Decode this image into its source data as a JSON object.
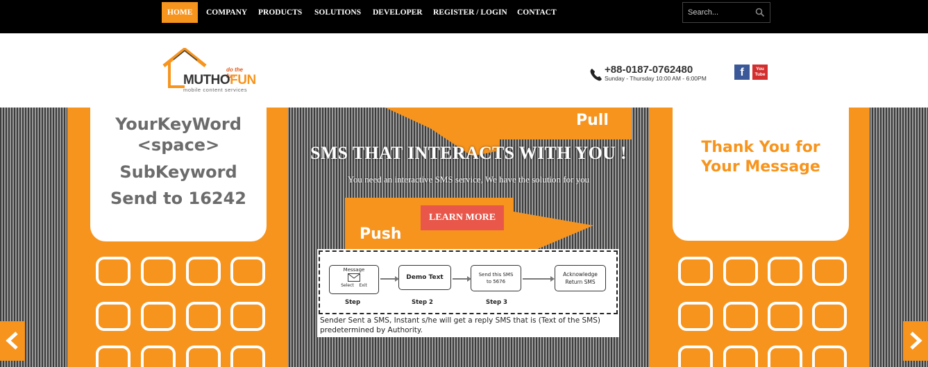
{
  "nav": {
    "items": [
      {
        "label": "HOME",
        "active": true
      },
      {
        "label": "COMPANY"
      },
      {
        "label": "PRODUCTS"
      },
      {
        "label": "SOLUTIONS"
      },
      {
        "label": "DEVELOPER"
      },
      {
        "label": "REGISTER / LOGIN"
      },
      {
        "label": "CONTACT"
      }
    ],
    "search_placeholder": "Search...",
    "search_icon": "search-icon"
  },
  "header": {
    "logo": {
      "tagline": "do the fun",
      "brand_a": "MUTHO",
      "brand_b": "FUN",
      "subtitle": "mobile content services"
    },
    "phone": {
      "icon": "phone-icon",
      "number": "+88-0187-0762480",
      "hours": "Sunday - Thursday 10:00 AM - 6:00PM"
    },
    "social": [
      {
        "name": "facebook-icon",
        "glyph": "f"
      },
      {
        "name": "youtube-icon",
        "glyph": "You Tube"
      }
    ]
  },
  "hero": {
    "left_screen": [
      "YourKeyWord",
      "<space>",
      "SubKeyword",
      "Send to 16242"
    ],
    "right_screen": [
      "Thank You for",
      "Your Message"
    ],
    "pull_label": "Pull",
    "push_label": "Push",
    "title": "SMS THAT INTERACTS WITH YOU !",
    "subtitle": "You need an interactive SMS service, We have the solution for you",
    "cta": "LEARN MORE",
    "prev_icon": "chevron-left-icon",
    "next_icon": "chevron-right-icon",
    "colors": {
      "accent": "#f7941d",
      "cta": "#e8574a"
    }
  },
  "diagram": {
    "steps": [
      {
        "title": "Message",
        "select": "Select",
        "exit": "Exit",
        "label": "Step"
      },
      {
        "title": "Demo Text",
        "label": "Step 2"
      },
      {
        "title": "Send this SMS to 5676",
        "label": "Step 3"
      },
      {
        "title": "Acknowledge Return SMS",
        "label": ""
      }
    ],
    "caption": "Sender Sent a SMS, Instant s/he will get a reply SMS that is (Text of the SMS) predetermined by Authority."
  }
}
